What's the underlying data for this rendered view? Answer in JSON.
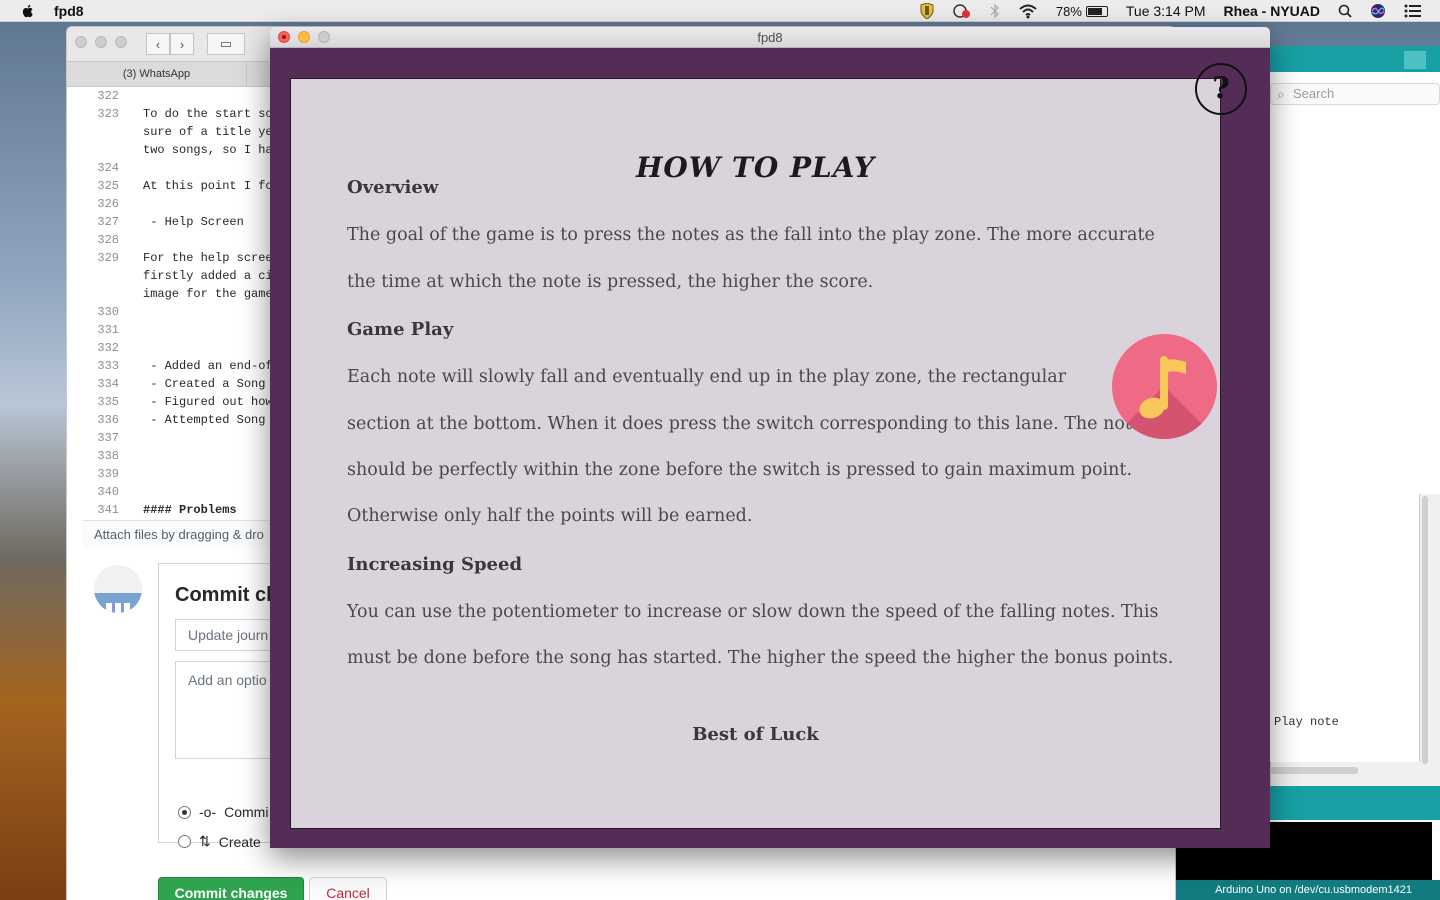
{
  "menubar": {
    "app_name": "fpd8",
    "battery": "78%",
    "clock": "Tue 3:14 PM",
    "user": "Rhea - NYUAD"
  },
  "browser": {
    "tab_label": "(3) WhatsApp",
    "editor_lines": [
      {
        "num": "322",
        "text": ""
      },
      {
        "num": "323",
        "text": "To do the start sc"
      },
      {
        "num": "",
        "text": "sure of a title ye"
      },
      {
        "num": "",
        "text": "two songs, so I ha"
      },
      {
        "num": "324",
        "text": ""
      },
      {
        "num": "325",
        "text": "At this point I fo"
      },
      {
        "num": "326",
        "text": ""
      },
      {
        "num": "327",
        "text": " - Help Screen"
      },
      {
        "num": "328",
        "text": ""
      },
      {
        "num": "329",
        "text": "For the help scree"
      },
      {
        "num": "",
        "text": "firstly added a ci"
      },
      {
        "num": "",
        "text": "image for the game"
      },
      {
        "num": "330",
        "text": ""
      },
      {
        "num": "331",
        "text": ""
      },
      {
        "num": "332",
        "text": ""
      },
      {
        "num": "333",
        "text": " - Added an end-of"
      },
      {
        "num": "334",
        "text": " - Created a Song"
      },
      {
        "num": "335",
        "text": " - Figured out how"
      },
      {
        "num": "336",
        "text": " - Attempted Song"
      },
      {
        "num": "337",
        "text": ""
      },
      {
        "num": "338",
        "text": ""
      },
      {
        "num": "339",
        "text": ""
      },
      {
        "num": "340",
        "text": ""
      },
      {
        "num": "341",
        "text": "#### Problems"
      }
    ],
    "attach_hint": "Attach files by dragging & dro",
    "commit": {
      "title": "Commit ch",
      "summary_placeholder": "Update journ",
      "description_placeholder": "Add an optio",
      "option_direct": "Commi",
      "option_branch": "Create",
      "commit_button": "Commit changes",
      "cancel_button": "Cancel"
    }
  },
  "arduino": {
    "search_placeholder": "Search",
    "code_snippet": "Play note",
    "status": "Arduino Uno on /dev/cu.usbmodem1421"
  },
  "game": {
    "window_title": "fpd8",
    "help_symbol": "?",
    "heading": "HOW TO PLAY",
    "sections": {
      "overview_title": "Overview",
      "overview_lines": [
        "The goal of the game is to press the notes as the fall into the play zone. The more accurate",
        "the time at which the note is pressed, the higher the score."
      ],
      "gameplay_title": "Game Play",
      "gameplay_lines": [
        "Each note will slowly fall and eventually end up in the play zone, the rectangular",
        "section at the bottom. When it does press the switch corresponding to this lane. The note",
        "should be perfectly within the zone before the switch is pressed to gain maximum point.",
        "Otherwise only half the points will be earned."
      ],
      "speed_title": "Increasing Speed",
      "speed_lines": [
        "You can use the potentiometer to increase or slow down the speed of the falling notes. This",
        "must be done before the song has started. The higher the speed the higher the bonus points."
      ],
      "closing": "Best of Luck"
    },
    "colors": {
      "frame": "#532d56",
      "panel": "#dad3dc",
      "note_circle": "#ee6a85",
      "note_glyph": "#f8c95a"
    }
  }
}
